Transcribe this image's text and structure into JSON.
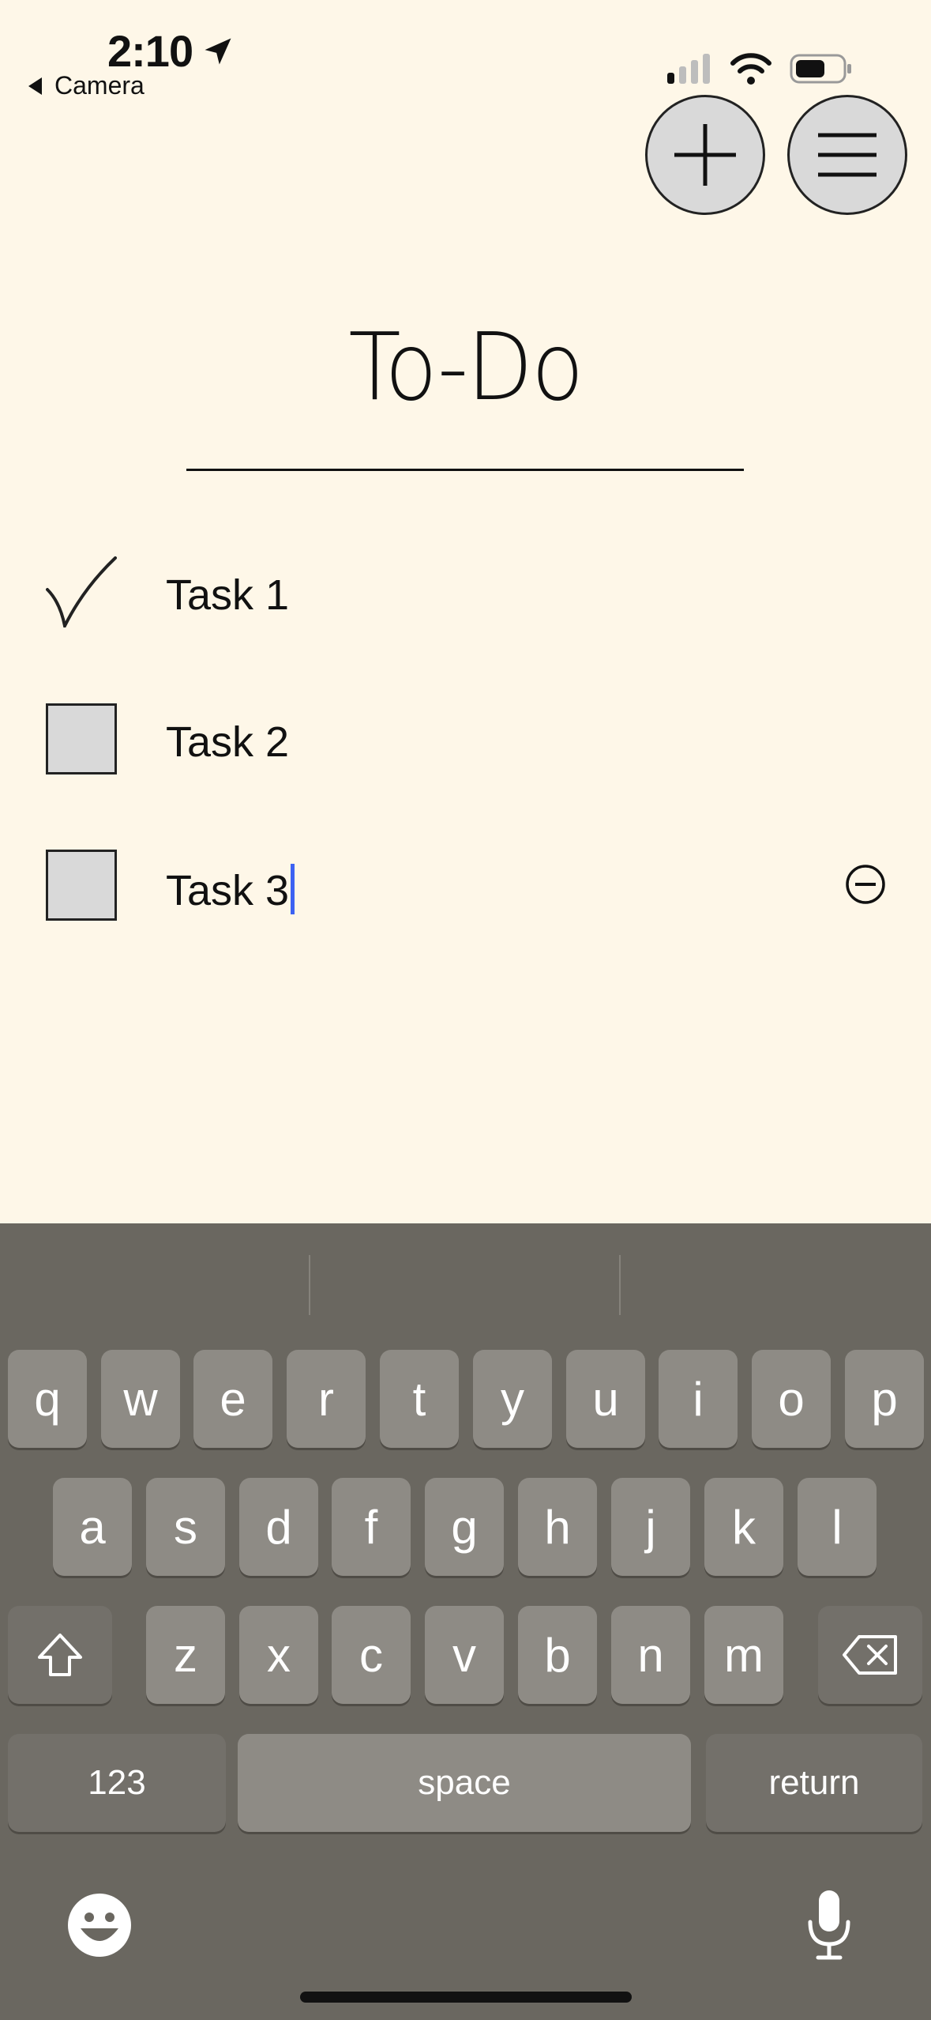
{
  "status_bar": {
    "time": "2:10",
    "back_app": "Camera",
    "icons": [
      "location-icon",
      "cellular-signal-icon",
      "wifi-icon",
      "battery-icon"
    ]
  },
  "top_buttons": {
    "add_icon": "plus-icon",
    "menu_icon": "hamburger-icon"
  },
  "title": "To-Do",
  "tasks": [
    {
      "label": "Task 1",
      "done": true
    },
    {
      "label": "Task 2",
      "done": false
    },
    {
      "label": "Task 3",
      "done": false,
      "editing": true
    }
  ],
  "keyboard": {
    "row1": [
      "q",
      "w",
      "e",
      "r",
      "t",
      "y",
      "u",
      "i",
      "o",
      "p"
    ],
    "row2": [
      "a",
      "s",
      "d",
      "f",
      "g",
      "h",
      "j",
      "k",
      "l"
    ],
    "row3": [
      "z",
      "x",
      "c",
      "v",
      "b",
      "n",
      "m"
    ],
    "numbers_label": "123",
    "space_label": "space",
    "return_label": "return"
  },
  "colors": {
    "background": "#fef7e8",
    "keyboard_bg": "#6a6760",
    "key_bg": "#8e8b85",
    "caret": "#3d62f2"
  }
}
